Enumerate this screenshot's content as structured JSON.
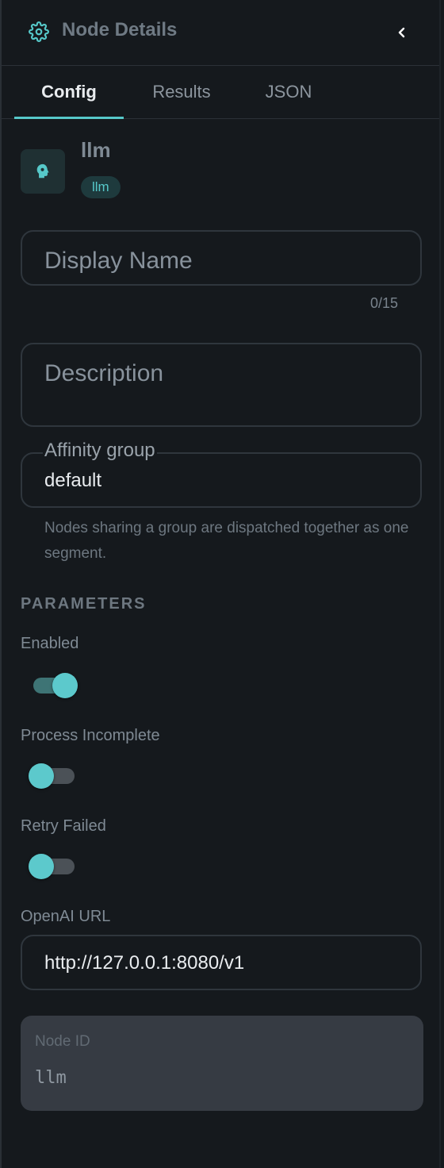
{
  "header": {
    "title": "Node Details",
    "icon": "gear-icon",
    "collapse_icon": "chevron-left-icon"
  },
  "tabs": [
    {
      "label": "Config",
      "active": true
    },
    {
      "label": "Results",
      "active": false
    },
    {
      "label": "JSON",
      "active": false
    }
  ],
  "node": {
    "name": "llm",
    "type_badge": "llm",
    "icon": "brain-head-icon"
  },
  "display_name": {
    "placeholder": "Display Name",
    "value": "",
    "counter": "0/15"
  },
  "description": {
    "placeholder": "Description",
    "value": ""
  },
  "affinity_group": {
    "label": "Affinity group",
    "value": "default",
    "hint": "Nodes sharing a group are dispatched together as one segment."
  },
  "parameters": {
    "section_title": "PARAMETERS",
    "enabled": {
      "label": "Enabled",
      "checked": true
    },
    "process_incomplete": {
      "label": "Process Incomplete",
      "checked": false
    },
    "retry_failed": {
      "label": "Retry Failed",
      "checked": false
    },
    "openai_url": {
      "label": "OpenAI URL",
      "value": "http://127.0.0.1:8080/v1"
    }
  },
  "node_id": {
    "label": "Node ID",
    "value": "llm"
  },
  "colors": {
    "accent": "#56c8c9",
    "background": "#15191d",
    "border": "#2f363d"
  }
}
